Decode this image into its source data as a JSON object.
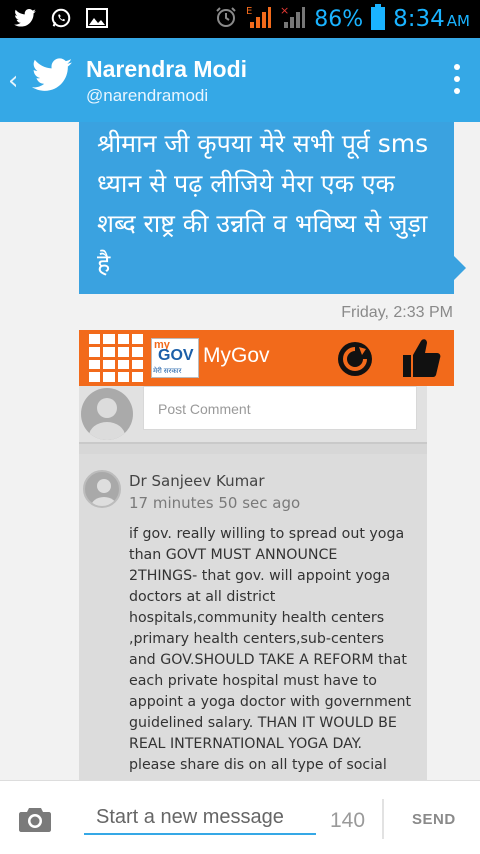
{
  "status_bar": {
    "battery": "86%",
    "time": "8:34",
    "ampm": "AM",
    "icons": [
      "twitter-icon",
      "whatsapp-icon",
      "gallery-icon",
      "alarm-icon",
      "signal-e-icon",
      "signal-icon",
      "battery-icon"
    ],
    "accent_color": "#1ab3ff"
  },
  "header": {
    "name": "Narendra Modi",
    "handle": "@narendramodi",
    "color": "#35a8e6"
  },
  "messages": {
    "text": "श्रीमान जी कृपया मेरे सभी पूर्व sms ध्यान से पढ़ लीजिये मेरा एक एक शब्द राष्ट्र की उन्नति व भविष्य से जुड़ा है",
    "timestamp": "Friday, 2:33 PM",
    "bubble_color": "#3aa2e0"
  },
  "screenshot": {
    "logo_my": "my",
    "logo_gov": "GOV",
    "logo_tagline": "मेरी सरकार",
    "app_title": "MyGov",
    "post_placeholder": "Post Comment",
    "author": "Dr Sanjeev Kumar",
    "ago": "17 minutes 50 sec ago",
    "comment": "if gov. really willing to spread out yoga\nthan GOVT MUST ANNOUNCE\n2THINGS- that gov. will appoint yoga\ndoctors at all district\nhospitals,community health centers\n,primary health centers,sub-centers\nand GOV.SHOULD TAKE A REFORM that\neach private hospital must have to\nappoint a yoga doctor with government\nguidelined salary. THAN IT WOULD BE\nREAL INTERNATIONAL YOGA DAY.\nplease share dis on all type of social",
    "bar_color": "#f26a1b"
  },
  "compose": {
    "placeholder": "Start a new message",
    "counter": "140",
    "send_label": "SEND"
  }
}
